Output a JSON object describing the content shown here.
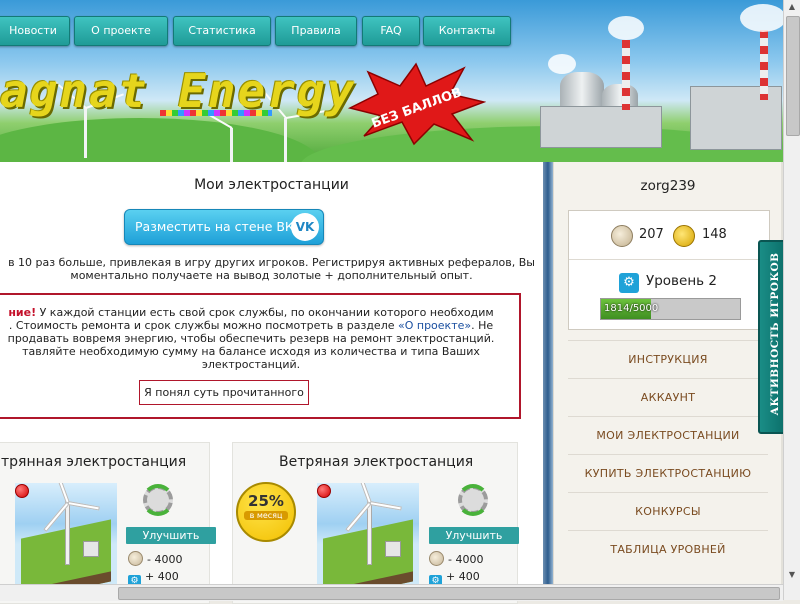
{
  "nav": {
    "items": [
      "Новости",
      "О проекте",
      "Статистика",
      "Правила",
      "FAQ",
      "Контакты"
    ]
  },
  "logo": {
    "text": "agnat Energy",
    "badge": "БЕЗ БАЛЛОВ"
  },
  "main": {
    "title": "Мои электростанции",
    "vk_button": "Разместить на стене ВК",
    "vk_logo": "VK",
    "referral_line1": "в 10 раз больше, привлекая в игру других игроков. Регистрируя активных рефералов, Вы",
    "referral_line2": "моментально получаете на вывод золотые + дополнительный опыт.",
    "warning": {
      "prefix": "ние!",
      "line1": " У каждой станции есть свой срок службы, по окончании которого необходим",
      "line2a": ". Стоимость ремонта и срок службы можно посмотреть в разделе ",
      "line2_link": "«О проекте»",
      "line2b": ". Не",
      "line3": "продавать вовремя энергию, чтобы обеспечить резерв на ремонт электростанций.",
      "line4": "тавляйте необходимую сумму на балансе исходя из количества и типа Ваших",
      "line5": "электростанций.",
      "ack_button": "Я понял суть прочитанного"
    },
    "stations": [
      {
        "title": "трянная электростанция",
        "upgrade": "Улучшить",
        "cost": "- 4000",
        "gain": "+ 400"
      },
      {
        "title": "Ветряная электростанция",
        "upgrade": "Улучшить",
        "cost": "- 4000",
        "gain": "+ 400",
        "percent": "25%",
        "percent_label": "в месяц"
      }
    ]
  },
  "sidebar": {
    "username": "zorg239",
    "silver": "207",
    "gold": "148",
    "level": "Уровень 2",
    "progress": {
      "text": "1814/5000",
      "current": 1814,
      "max": 5000
    },
    "menu": [
      "ИНСТРУКЦИЯ",
      "АККАУНТ",
      "МОИ ЭЛЕКТРОСТАНЦИИ",
      "КУПИТЬ ЭЛЕКТРОСТАНЦИЮ",
      "КОНКУРСЫ",
      "ТАБЛИЦА УРОВНЕЙ"
    ]
  },
  "activity_tab": "АКТИВНОСТЬ ИГРОКОВ",
  "colors": {
    "accent": "#2fa0a0",
    "warning": "#b0162b",
    "vk": "#1ea0d8",
    "menu_text": "#7a4b20"
  }
}
